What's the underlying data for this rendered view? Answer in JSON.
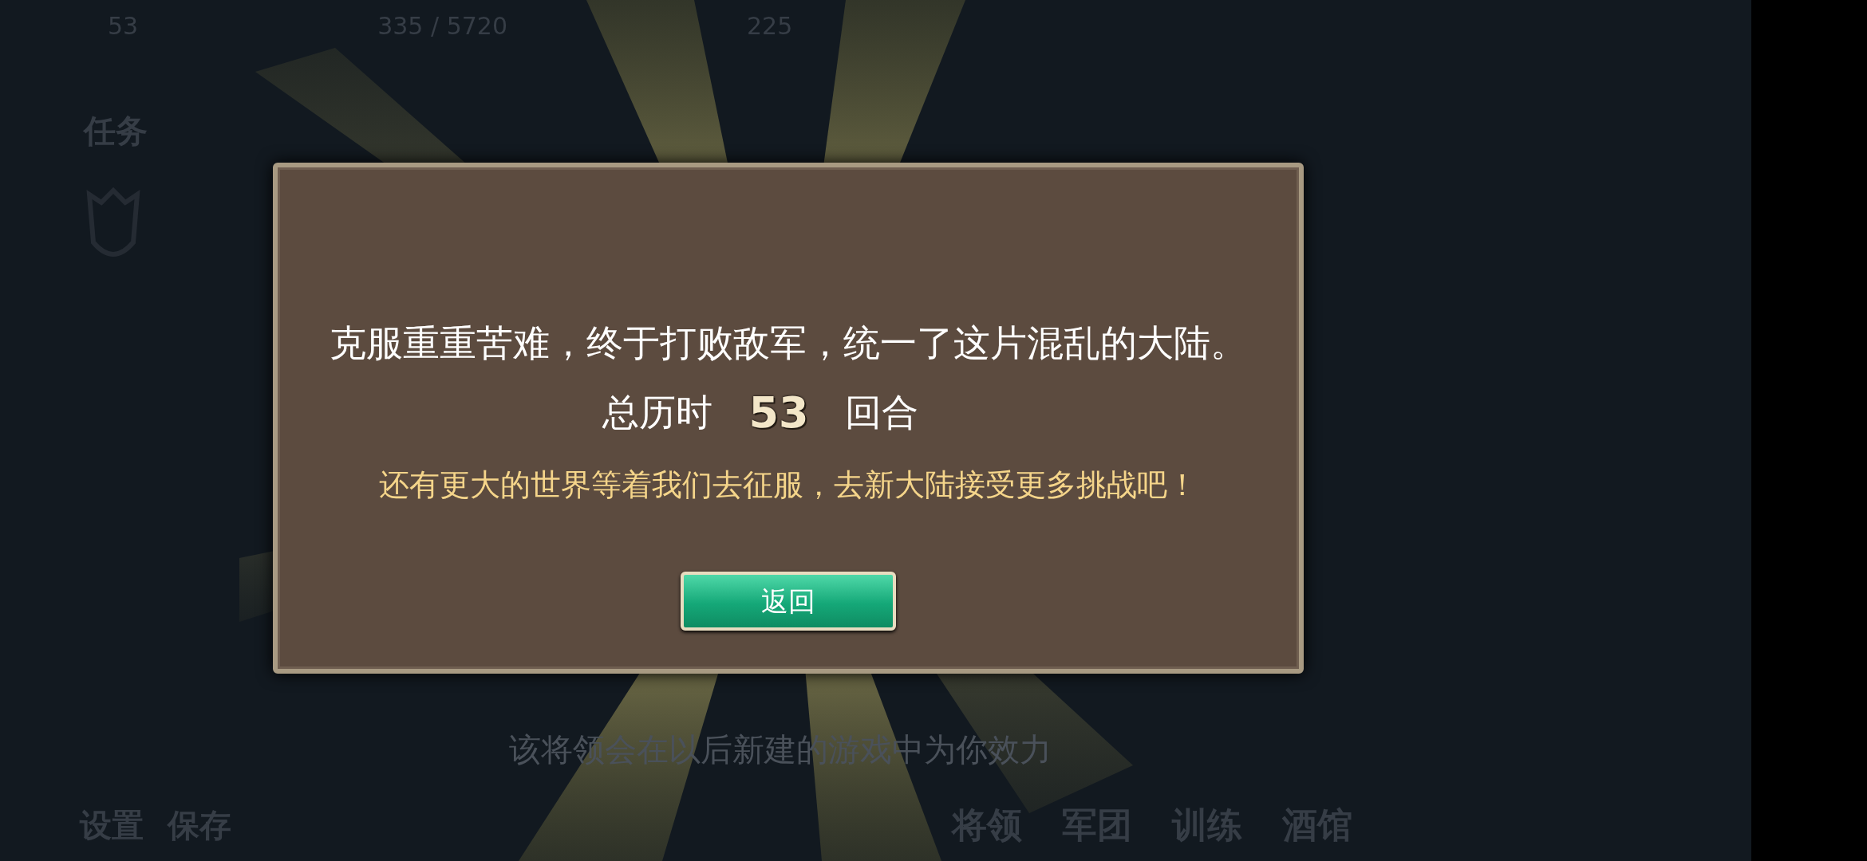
{
  "top_bar": [
    "53",
    "335 / 5720",
    "225"
  ],
  "side_menu": [
    "任务"
  ],
  "bottom_left": [
    "设置",
    "保存"
  ],
  "notice": "该将领会在以后新建的游戏中为你效力",
  "bottom_menu": [
    "将领",
    "军团",
    "训练",
    "酒馆"
  ],
  "dialog": {
    "message": "克服重重苦难，终于打败敌军，统一了这片混乱的大陆。",
    "turns_label": "总历时",
    "turns": "53",
    "turns_unit": "回合",
    "prompt": "还有更大的世界等着我们去征服，去新大陆接受更多挑战吧！",
    "button": "返回"
  }
}
